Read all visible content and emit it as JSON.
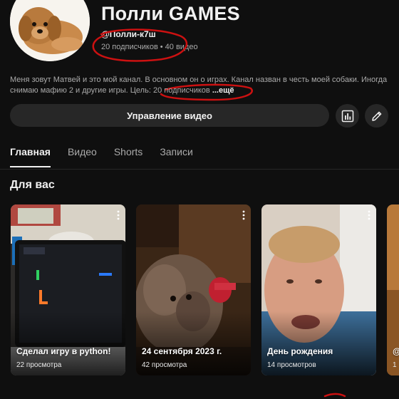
{
  "header": {
    "channel_name": "Полли GAMES",
    "handle": "@Полли-к7ш",
    "subscribers": "20 подписчиков",
    "stats_separator": "•",
    "videos_count": "40 видео"
  },
  "description": {
    "text": "Меня зовут Матвей и это мой канал. В основном он о играх. Канал назван в честь моей собаки. Иногда снимаю мафию 2 и другие игры. Цель: 20 подписчиков ",
    "more_label": "...ещё"
  },
  "actions": {
    "manage_label": "Управление видео",
    "stats_icon": "analytics-icon",
    "edit_icon": "pencil-icon"
  },
  "tabs": [
    {
      "label": "Главная",
      "active": true
    },
    {
      "label": "Видео",
      "active": false
    },
    {
      "label": "Shorts",
      "active": false
    },
    {
      "label": "Записи",
      "active": false
    }
  ],
  "section": {
    "title": "Для вас"
  },
  "shorts": [
    {
      "title": "Сделал игру в python!",
      "views": "22 просмотра"
    },
    {
      "title": "24 сентября 2023 г.",
      "views": "42 просмотра"
    },
    {
      "title": "День рождения",
      "views": "14 просмотров"
    },
    {
      "title": "@",
      "views": "1"
    }
  ],
  "colors": {
    "background": "#0f0f0f",
    "button_bg": "#272727",
    "text_primary": "#f1f1f1",
    "text_secondary": "#aaaaaa",
    "annotation_red": "#cc1111"
  }
}
